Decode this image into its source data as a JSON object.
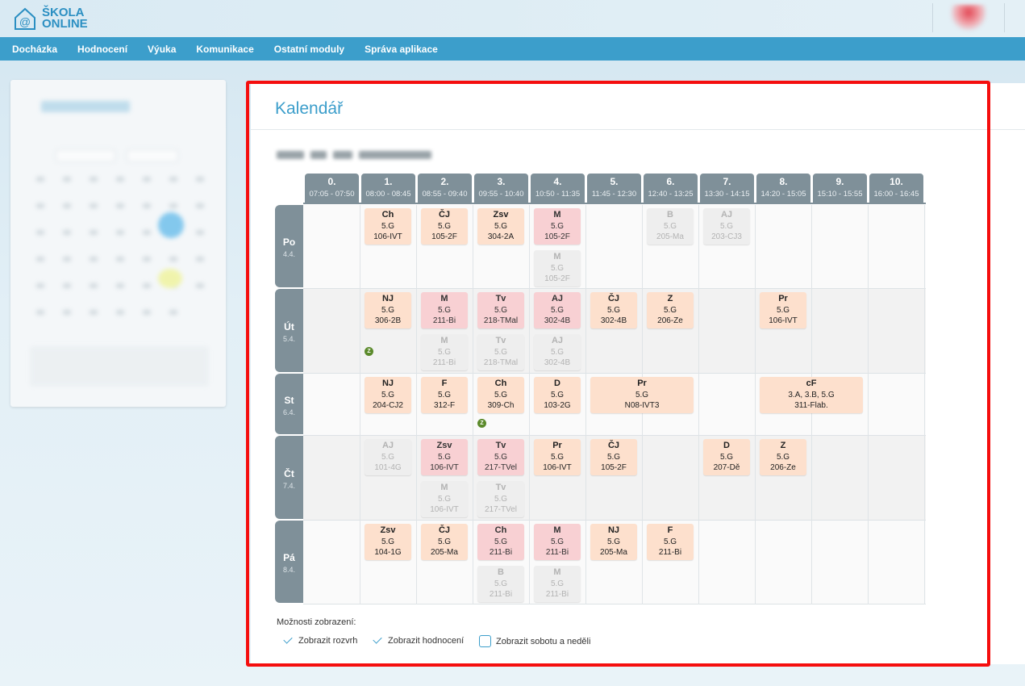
{
  "header": {
    "logo_line1": "ŠKOLA",
    "logo_line2": "ONLINE"
  },
  "menu": [
    "Docházka",
    "Hodnocení",
    "Výuka",
    "Komunikace",
    "Ostatní moduly",
    "Správa aplikace"
  ],
  "page": {
    "title": "Kalendář"
  },
  "periods": [
    {
      "num": "0.",
      "time": "07:05 - 07:50"
    },
    {
      "num": "1.",
      "time": "08:00 - 08:45"
    },
    {
      "num": "2.",
      "time": "08:55 - 09:40"
    },
    {
      "num": "3.",
      "time": "09:55 - 10:40"
    },
    {
      "num": "4.",
      "time": "10:50 - 11:35"
    },
    {
      "num": "5.",
      "time": "11:45 - 12:30"
    },
    {
      "num": "6.",
      "time": "12:40 - 13:25"
    },
    {
      "num": "7.",
      "time": "13:30 - 14:15"
    },
    {
      "num": "8.",
      "time": "14:20 - 15:05"
    },
    {
      "num": "9.",
      "time": "15:10 - 15:55"
    },
    {
      "num": "10.",
      "time": "16:00 - 16:45"
    }
  ],
  "days": [
    {
      "name": "Po",
      "date": "4.4."
    },
    {
      "name": "Út",
      "date": "5.4."
    },
    {
      "name": "St",
      "date": "6.4."
    },
    {
      "name": "Čt",
      "date": "7.4."
    },
    {
      "name": "Pá",
      "date": "8.4."
    }
  ],
  "lessons": [
    {
      "day": 0,
      "period": 1,
      "span": 1,
      "stack": 0,
      "subject": "Ch",
      "group": "5.G",
      "room": "106-IVT",
      "style": "peach"
    },
    {
      "day": 0,
      "period": 2,
      "span": 1,
      "stack": 0,
      "subject": "ČJ",
      "group": "5.G",
      "room": "105-2F",
      "style": "peach"
    },
    {
      "day": 0,
      "period": 3,
      "span": 1,
      "stack": 0,
      "subject": "Zsv",
      "group": "5.G",
      "room": "304-2A",
      "style": "peach"
    },
    {
      "day": 0,
      "period": 4,
      "span": 1,
      "stack": 0,
      "subject": "M",
      "group": "5.G",
      "room": "105-2F",
      "style": "pink"
    },
    {
      "day": 0,
      "period": 4,
      "span": 1,
      "stack": 1,
      "subject": "M",
      "group": "5.G",
      "room": "105-2F",
      "style": "grey"
    },
    {
      "day": 0,
      "period": 6,
      "span": 1,
      "stack": 0,
      "subject": "B",
      "group": "5.G",
      "room": "205-Ma",
      "style": "grey"
    },
    {
      "day": 0,
      "period": 7,
      "span": 1,
      "stack": 0,
      "subject": "AJ",
      "group": "5.G",
      "room": "203-CJ3",
      "style": "grey"
    },
    {
      "day": 1,
      "period": 1,
      "span": 1,
      "stack": 0,
      "subject": "NJ",
      "group": "5.G",
      "room": "306-2B",
      "style": "peach"
    },
    {
      "day": 1,
      "period": 2,
      "span": 1,
      "stack": 0,
      "subject": "M",
      "group": "5.G",
      "room": "211-Bi",
      "style": "pink"
    },
    {
      "day": 1,
      "period": 2,
      "span": 1,
      "stack": 1,
      "subject": "M",
      "group": "5.G",
      "room": "211-Bi",
      "style": "grey"
    },
    {
      "day": 1,
      "period": 3,
      "span": 1,
      "stack": 0,
      "subject": "Tv",
      "group": "5.G",
      "room": "218-TMal",
      "style": "pink"
    },
    {
      "day": 1,
      "period": 3,
      "span": 1,
      "stack": 1,
      "subject": "Tv",
      "group": "5.G",
      "room": "218-TMal",
      "style": "grey"
    },
    {
      "day": 1,
      "period": 4,
      "span": 1,
      "stack": 0,
      "subject": "AJ",
      "group": "5.G",
      "room": "302-4B",
      "style": "pink"
    },
    {
      "day": 1,
      "period": 4,
      "span": 1,
      "stack": 1,
      "subject": "AJ",
      "group": "5.G",
      "room": "302-4B",
      "style": "grey"
    },
    {
      "day": 1,
      "period": 5,
      "span": 1,
      "stack": 0,
      "subject": "ČJ",
      "group": "5.G",
      "room": "302-4B",
      "style": "peach"
    },
    {
      "day": 1,
      "period": 6,
      "span": 1,
      "stack": 0,
      "subject": "Z",
      "group": "5.G",
      "room": "206-Ze",
      "style": "peach"
    },
    {
      "day": 1,
      "period": 8,
      "span": 1,
      "stack": 0,
      "subject": "Pr",
      "group": "5.G",
      "room": "106-IVT",
      "style": "peach"
    },
    {
      "day": 2,
      "period": 1,
      "span": 1,
      "stack": 0,
      "subject": "NJ",
      "group": "5.G",
      "room": "204-CJ2",
      "style": "peach"
    },
    {
      "day": 2,
      "period": 2,
      "span": 1,
      "stack": 0,
      "subject": "F",
      "group": "5.G",
      "room": "312-F",
      "style": "peach"
    },
    {
      "day": 2,
      "period": 3,
      "span": 1,
      "stack": 0,
      "subject": "Ch",
      "group": "5.G",
      "room": "309-Ch",
      "style": "peach"
    },
    {
      "day": 2,
      "period": 4,
      "span": 1,
      "stack": 0,
      "subject": "D",
      "group": "5.G",
      "room": "103-2G",
      "style": "peach"
    },
    {
      "day": 2,
      "period": 5,
      "span": 2,
      "stack": 0,
      "subject": "Pr",
      "group": "5.G",
      "room": "N08-IVT3",
      "style": "peach"
    },
    {
      "day": 2,
      "period": 8,
      "span": 2,
      "stack": 0,
      "subject": "cF",
      "group": "3.A, 3.B, 5.G",
      "room": "311-Flab.",
      "style": "peach"
    },
    {
      "day": 3,
      "period": 1,
      "span": 1,
      "stack": 0,
      "subject": "AJ",
      "group": "5.G",
      "room": "101-4G",
      "style": "grey"
    },
    {
      "day": 3,
      "period": 2,
      "span": 1,
      "stack": 0,
      "subject": "Zsv",
      "group": "5.G",
      "room": "106-IVT",
      "style": "pink"
    },
    {
      "day": 3,
      "period": 2,
      "span": 1,
      "stack": 1,
      "subject": "M",
      "group": "5.G",
      "room": "106-IVT",
      "style": "grey"
    },
    {
      "day": 3,
      "period": 3,
      "span": 1,
      "stack": 0,
      "subject": "Tv",
      "group": "5.G",
      "room": "217-TVel",
      "style": "pink"
    },
    {
      "day": 3,
      "period": 3,
      "span": 1,
      "stack": 1,
      "subject": "Tv",
      "group": "5.G",
      "room": "217-TVel",
      "style": "grey"
    },
    {
      "day": 3,
      "period": 4,
      "span": 1,
      "stack": 0,
      "subject": "Pr",
      "group": "5.G",
      "room": "106-IVT",
      "style": "peach"
    },
    {
      "day": 3,
      "period": 5,
      "span": 1,
      "stack": 0,
      "subject": "ČJ",
      "group": "5.G",
      "room": "105-2F",
      "style": "peach"
    },
    {
      "day": 3,
      "period": 7,
      "span": 1,
      "stack": 0,
      "subject": "D",
      "group": "5.G",
      "room": "207-Dě",
      "style": "peach"
    },
    {
      "day": 3,
      "period": 8,
      "span": 1,
      "stack": 0,
      "subject": "Z",
      "group": "5.G",
      "room": "206-Ze",
      "style": "peach"
    },
    {
      "day": 4,
      "period": 1,
      "span": 1,
      "stack": 0,
      "subject": "Zsv",
      "group": "5.G",
      "room": "104-1G",
      "style": "peach"
    },
    {
      "day": 4,
      "period": 2,
      "span": 1,
      "stack": 0,
      "subject": "ČJ",
      "group": "5.G",
      "room": "205-Ma",
      "style": "peach"
    },
    {
      "day": 4,
      "period": 3,
      "span": 1,
      "stack": 0,
      "subject": "Ch",
      "group": "5.G",
      "room": "211-Bi",
      "style": "pink"
    },
    {
      "day": 4,
      "period": 3,
      "span": 1,
      "stack": 1,
      "subject": "B",
      "group": "5.G",
      "room": "211-Bi",
      "style": "grey"
    },
    {
      "day": 4,
      "period": 4,
      "span": 1,
      "stack": 0,
      "subject": "M",
      "group": "5.G",
      "room": "211-Bi",
      "style": "pink"
    },
    {
      "day": 4,
      "period": 4,
      "span": 1,
      "stack": 1,
      "subject": "M",
      "group": "5.G",
      "room": "211-Bi",
      "style": "grey"
    },
    {
      "day": 4,
      "period": 5,
      "span": 1,
      "stack": 0,
      "subject": "NJ",
      "group": "5.G",
      "room": "205-Ma",
      "style": "peach"
    },
    {
      "day": 4,
      "period": 6,
      "span": 1,
      "stack": 0,
      "subject": "F",
      "group": "5.G",
      "room": "211-Bi",
      "style": "peach"
    }
  ],
  "markers": [
    {
      "day": 1,
      "period": 1,
      "label": "Z"
    },
    {
      "day": 2,
      "period": 3,
      "label": "Z"
    }
  ],
  "options": {
    "label": "Možnosti zobrazení:",
    "items": [
      {
        "label": "Zobrazit rozvrh",
        "checked": true
      },
      {
        "label": "Zobrazit hodnocení",
        "checked": true
      },
      {
        "label": "Zobrazit sobotu a neděli",
        "checked": false
      }
    ]
  },
  "colors": {
    "accent": "#3c9ecb",
    "header_gray": "#7f9099",
    "lesson_peach": "#fde0cd",
    "lesson_pink": "#f8d0d3",
    "lesson_grey": "#eeeeee",
    "frame_red": "#f50e0e",
    "marker_green": "#5b8a2b"
  }
}
